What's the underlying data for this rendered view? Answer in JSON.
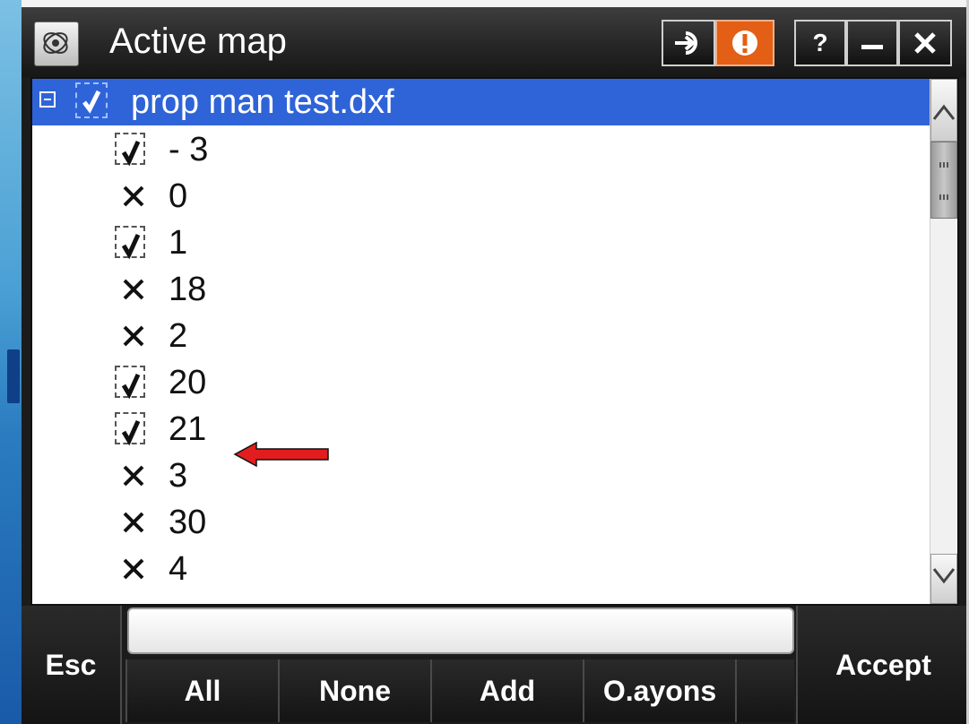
{
  "window": {
    "title": "Active map",
    "buttons": {
      "help": "?"
    }
  },
  "tree": {
    "root_label": "prop man test.dxf",
    "items": [
      {
        "label": "- 3",
        "checked": true
      },
      {
        "label": "0",
        "checked": false
      },
      {
        "label": "1",
        "checked": true
      },
      {
        "label": "18",
        "checked": false
      },
      {
        "label": "2",
        "checked": false
      },
      {
        "label": "20",
        "checked": true
      },
      {
        "label": "21",
        "checked": true
      },
      {
        "label": "3",
        "checked": false
      },
      {
        "label": "30",
        "checked": false
      },
      {
        "label": "4",
        "checked": false
      }
    ]
  },
  "softkeys": {
    "esc": "Esc",
    "accept": "Accept",
    "all": "All",
    "none": "None",
    "add": "Add",
    "options": "O.ayons"
  },
  "colors": {
    "selection": "#2f63d8",
    "alert": "#e35f16",
    "arrow": "#e21d1d"
  }
}
